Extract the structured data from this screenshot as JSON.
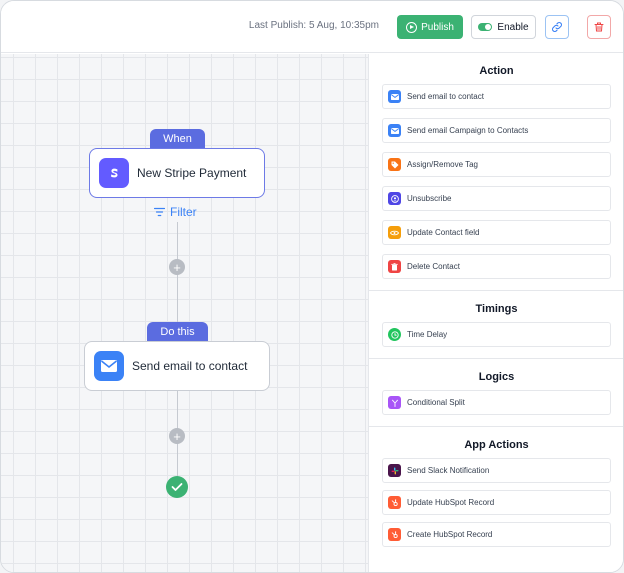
{
  "topbar": {
    "last_publish": "Last Publish: 5 Aug, 10:35pm",
    "publish_label": "Publish",
    "enable_label": "Enable"
  },
  "canvas": {
    "trigger": {
      "tag": "When",
      "label": "New Stripe Payment",
      "filter_label": "Filter"
    },
    "action": {
      "tag": "Do this",
      "label": "Send email to contact"
    }
  },
  "panel": {
    "sections": [
      {
        "title": "Action",
        "items": [
          {
            "label": "Send email to contact",
            "icon": "envelope-icon",
            "color": "#3b82f6"
          },
          {
            "label": "Send email Campaign to Contacts",
            "icon": "envelope-icon",
            "color": "#3b82f6"
          },
          {
            "label": "Assign/Remove Tag",
            "icon": "tag-icon",
            "color": "#f97316"
          },
          {
            "label": "Unsubscribe",
            "icon": "user-icon",
            "color": "#4f46e5"
          },
          {
            "label": "Update Contact field",
            "icon": "eye-icon",
            "color": "#f59e0b"
          },
          {
            "label": "Delete Contact",
            "icon": "trash-icon",
            "color": "#ef4444"
          }
        ]
      },
      {
        "title": "Timings",
        "items": [
          {
            "label": "Time Delay",
            "icon": "clock-icon",
            "color": "#22c55e"
          }
        ]
      },
      {
        "title": "Logics",
        "items": [
          {
            "label": "Conditional Split",
            "icon": "split-icon",
            "color": "#a855f7"
          }
        ]
      },
      {
        "title": "App Actions",
        "items": [
          {
            "label": "Send Slack Notification",
            "icon": "slack-icon",
            "color": "#4a154b"
          },
          {
            "label": "Update HubSpot Record",
            "icon": "hubspot-icon",
            "color": "#ff5c35"
          },
          {
            "label": "Create HubSpot Record",
            "icon": "hubspot-icon",
            "color": "#ff5c35"
          }
        ]
      }
    ]
  },
  "colors": {
    "accent": "#5b6ce0",
    "success": "#3bb273",
    "link": "#3b82f6",
    "danger": "#ef4444"
  }
}
